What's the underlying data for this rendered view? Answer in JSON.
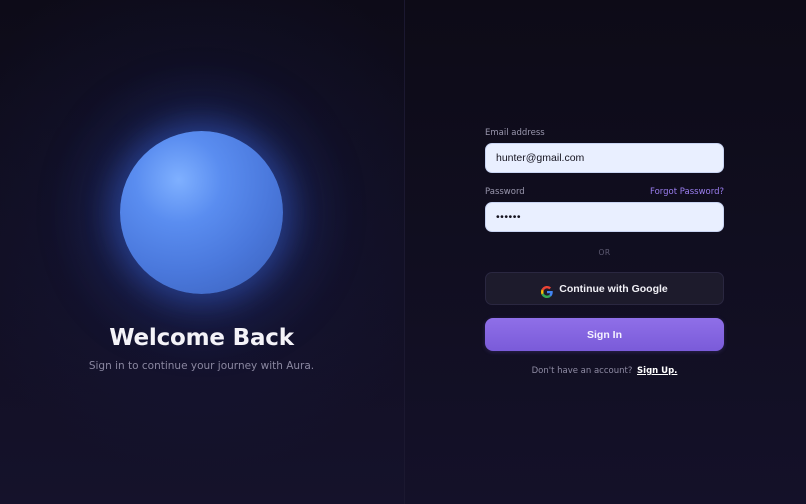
{
  "hero": {
    "title": "Welcome Back",
    "subtitle": "Sign in to continue your journey with Aura."
  },
  "form": {
    "email_label": "Email address",
    "email_value": "hunter@gmail.com",
    "password_label": "Password",
    "password_value": "hunter",
    "forgot_label": "Forgot Password?",
    "divider_label": "OR",
    "google_label": "Continue with Google",
    "google_icon": "google-g-icon",
    "signin_label": "Sign In",
    "signup_prompt": "Don't have an account?",
    "signup_link": "Sign Up."
  },
  "colors": {
    "accent": "#8a6be6",
    "background": "#0f0d1c",
    "orb": "#4a78dc",
    "input_bg": "#e9efff",
    "link": "#9b7ef0"
  }
}
